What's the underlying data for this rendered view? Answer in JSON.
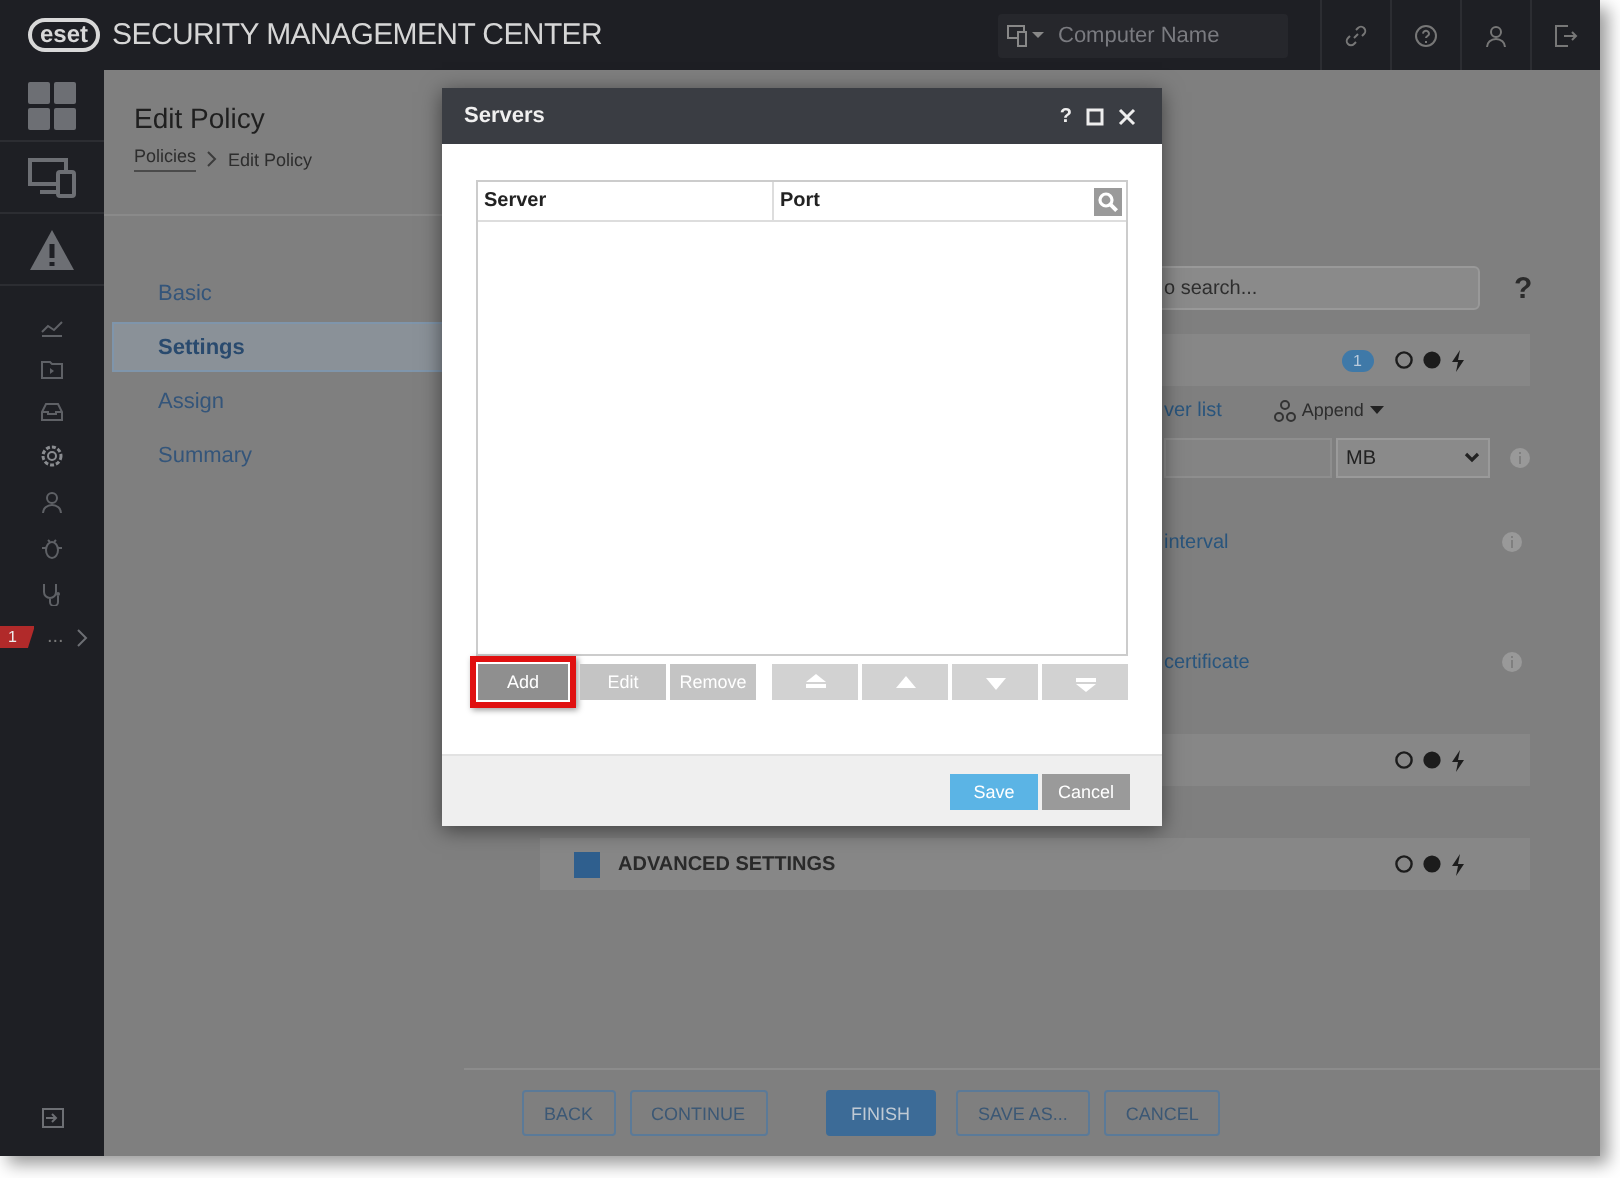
{
  "header": {
    "logo": "eset",
    "product": "SECURITY MANAGEMENT CENTER",
    "search": {
      "placeholder": "Computer Name"
    }
  },
  "sidebar": {
    "alert_badge": "1",
    "more": "..."
  },
  "page": {
    "title": "Edit Policy",
    "breadcrumb": [
      "Policies",
      "Edit Policy"
    ]
  },
  "steps": [
    {
      "label": "Basic",
      "selected": false
    },
    {
      "label": "Settings",
      "selected": true
    },
    {
      "label": "Assign",
      "selected": false
    },
    {
      "label": "Summary",
      "selected": false
    }
  ],
  "policy_settings": {
    "search": {
      "placeholder": "o search..."
    },
    "help": "?",
    "rows": [
      {
        "kind": "section",
        "badge": "1"
      },
      {
        "kind": "server_list",
        "link": "ver list",
        "action": "Append"
      },
      {
        "kind": "size",
        "unit": "MB"
      },
      {
        "kind": "option",
        "link": "interval"
      },
      {
        "kind": "option",
        "link": "certificate"
      },
      {
        "kind": "section"
      },
      {
        "kind": "section",
        "title": "ADVANCED SETTINGS",
        "checked": true
      }
    ]
  },
  "dialog": {
    "title": "Servers",
    "help": "?",
    "table": {
      "columns": [
        "Server",
        "Port"
      ]
    },
    "row_buttons": [
      {
        "label": "Add",
        "disabled": false,
        "highlighted": true
      },
      {
        "label": "Edit",
        "disabled": true,
        "highlighted": false
      },
      {
        "label": "Remove",
        "disabled": true,
        "highlighted": false
      }
    ],
    "save": "Save",
    "cancel": "Cancel"
  },
  "footer_buttons": [
    {
      "label": "BACK",
      "primary": false
    },
    {
      "label": "CONTINUE",
      "primary": false
    },
    {
      "label": "FINISH",
      "primary": true
    },
    {
      "label": "SAVE AS...",
      "primary": false
    },
    {
      "label": "CANCEL",
      "primary": false
    }
  ]
}
